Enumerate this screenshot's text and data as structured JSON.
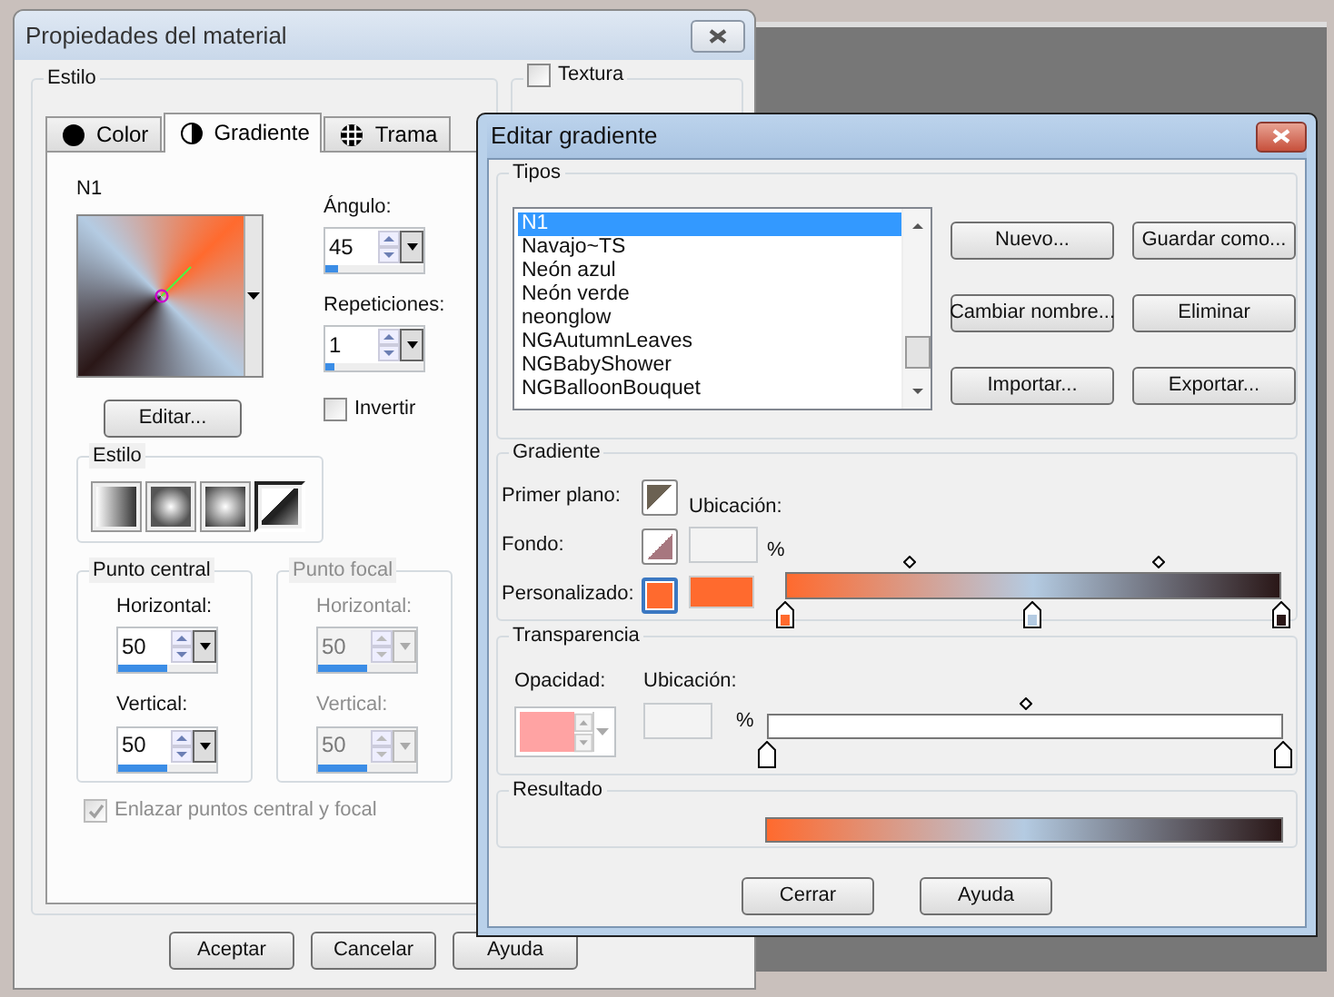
{
  "material_window": {
    "title": "Propiedades del material",
    "style_group": "Estilo",
    "texture": {
      "label": "Textura",
      "checked": false
    },
    "tabs": [
      {
        "label": "Color",
        "selected": false
      },
      {
        "label": "Gradiente",
        "selected": true
      },
      {
        "label": "Trama",
        "selected": false
      }
    ],
    "gradient_name": "N1",
    "angle": {
      "label": "Ángulo:",
      "value": "45",
      "level": 0.13
    },
    "repetitions": {
      "label": "Repeticiones:",
      "value": "1",
      "level": 0.1
    },
    "edit_button": "Editar...",
    "invert": {
      "label": "Invertir",
      "checked": false
    },
    "style": {
      "title": "Estilo",
      "options": [
        {
          "kind": "linear",
          "selected": false
        },
        {
          "kind": "rectangular",
          "selected": false
        },
        {
          "kind": "radial",
          "selected": false
        },
        {
          "kind": "angular",
          "selected": true
        }
      ]
    },
    "points": [
      {
        "title": "Punto central",
        "disabled": false,
        "fields": [
          {
            "label": "Horizontal:",
            "value": "50",
            "level": 0.5
          },
          {
            "label": "Vertical:",
            "value": "50",
            "level": 0.5
          }
        ]
      },
      {
        "title": "Punto focal",
        "disabled": true,
        "fields": [
          {
            "label": "Horizontal:",
            "value": "50",
            "level": 0.5
          },
          {
            "label": "Vertical:",
            "value": "50",
            "level": 0.5
          }
        ]
      }
    ],
    "link_points": {
      "label": "Enlazar puntos central y focal",
      "checked": true,
      "disabled": true
    },
    "buttons": [
      "Aceptar",
      "Cancelar",
      "Ayuda"
    ]
  },
  "gradient_editor": {
    "title": "Editar gradiente",
    "types": {
      "title": "Tipos",
      "items": [
        {
          "label": "N1",
          "selected": true
        },
        {
          "label": "Navajo~TS",
          "selected": false
        },
        {
          "label": "Neón azul",
          "selected": false
        },
        {
          "label": "Neón verde",
          "selected": false
        },
        {
          "label": "neonglow",
          "selected": false
        },
        {
          "label": "NGAutumnLeaves",
          "selected": false
        },
        {
          "label": "NGBabyShower",
          "selected": false
        },
        {
          "label": "NGBalloonBouquet",
          "selected": false
        }
      ],
      "buttons": [
        "Nuevo...",
        "Guardar como...",
        "Cambiar nombre...",
        "Eliminar",
        "Importar...",
        "Exportar..."
      ]
    },
    "gradient": {
      "title": "Gradiente",
      "location_label": "Ubicación:",
      "percent": "%",
      "sources": [
        {
          "kind": "foreground",
          "label": "Primer plano:",
          "color": "#6b6152",
          "selected": false
        },
        {
          "kind": "background",
          "label": "Fondo:",
          "color": "#a7777f",
          "selected": false
        },
        {
          "kind": "custom",
          "label": "Personalizado:",
          "color": "#ff6a2e",
          "selected": true
        }
      ],
      "stops": [
        {
          "color": "#ff6a2e"
        },
        {
          "color": "#b4cbe2"
        },
        {
          "color": "#2a1717"
        }
      ]
    },
    "transparency": {
      "title": "Transparencia",
      "opacity_label": "Opacidad:",
      "location_label": "Ubicación:",
      "percent": "%"
    },
    "result": {
      "title": "Resultado"
    },
    "buttons": [
      "Cerrar",
      "Ayuda"
    ]
  }
}
